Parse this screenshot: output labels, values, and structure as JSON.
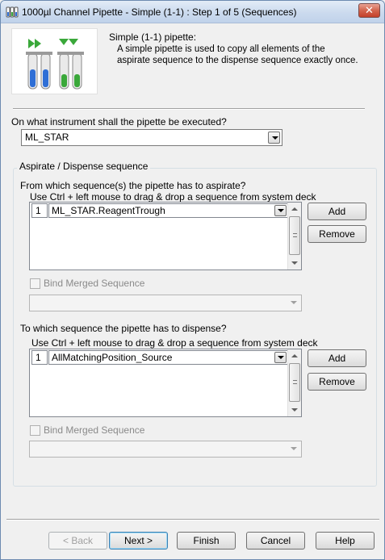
{
  "window": {
    "title": "1000µl Channel Pipette - Simple (1-1) : Step 1 of 5 (Sequences)",
    "close_label": "✕"
  },
  "header": {
    "title": "Simple (1-1) pipette:",
    "description": "A simple pipette is used to copy all elements of the aspirate sequence to the dispense sequence exactly once."
  },
  "instrument": {
    "question": "On what instrument shall the pipette be executed?",
    "selected": "ML_STAR"
  },
  "sequence_group": {
    "title": "Aspirate / Dispense sequence",
    "aspirate": {
      "question": "From which sequence(s) the pipette has to aspirate?",
      "hint": "Use Ctrl + left mouse to drag & drop a sequence from system deck",
      "rows": [
        {
          "num": "1",
          "value": "ML_STAR.ReagentTrough"
        }
      ],
      "add_label": "Add",
      "remove_label": "Remove",
      "bind_label": "Bind Merged Sequence",
      "merged_value": ""
    },
    "dispense": {
      "question": "To which sequence the pipette has to dispense?",
      "hint": "Use Ctrl + left mouse to drag & drop a sequence from system deck",
      "rows": [
        {
          "num": "1",
          "value": "AllMatchingPosition_Source"
        }
      ],
      "add_label": "Add",
      "remove_label": "Remove",
      "bind_label": "Bind Merged Sequence",
      "merged_value": ""
    }
  },
  "footer": {
    "back_label": "< Back",
    "next_label": "Next >",
    "finish_label": "Finish",
    "cancel_label": "Cancel",
    "help_label": "Help"
  },
  "colors": {
    "accent_blue": "#2f6fd6",
    "accent_green": "#3aa83a"
  }
}
